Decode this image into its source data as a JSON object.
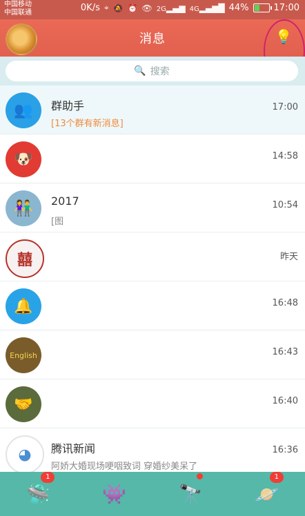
{
  "status_bar": {
    "carrier_1": "中国移动",
    "carrier_2": "中国联通",
    "net_speed": "0K/s",
    "net_type_1": "2G",
    "net_type_2": "4G",
    "battery_percent": "44%",
    "battery_level": 0.44,
    "time": "17:00"
  },
  "header": {
    "title": "消息",
    "bulb_icon": "lightbulb-icon"
  },
  "search": {
    "placeholder": "搜索"
  },
  "conversations": [
    {
      "title": "群助手",
      "subtitle": "[13个群有新消息]",
      "time": "17:00",
      "avatar_icon": "contacts-icon"
    },
    {
      "title": "",
      "subtitle": "",
      "time": "14:58",
      "avatar_icon": "jd-dog-icon"
    },
    {
      "title": "2017",
      "subtitle": "[图",
      "time": "10:54",
      "avatar_icon": "couple-icon"
    },
    {
      "title": "",
      "subtitle": "",
      "time": "昨天",
      "avatar_icon": "seal-icon"
    },
    {
      "title": "",
      "subtitle": "",
      "time": "16:48",
      "avatar_icon": "bell-icon"
    },
    {
      "title": "",
      "subtitle": "",
      "time": "16:43",
      "avatar_icon": "english-icon"
    },
    {
      "title": "",
      "subtitle": "",
      "time": "16:40",
      "avatar_icon": "handshake-icon"
    },
    {
      "title": "腾讯新闻",
      "subtitle": "阿娇大婚现场哽咽致词 穿婚纱美呆了",
      "time": "16:36",
      "avatar_icon": "news-icon"
    }
  ],
  "bottom_nav": [
    {
      "name": "messages",
      "badge": "1"
    },
    {
      "name": "contacts",
      "badge": ""
    },
    {
      "name": "dynamic",
      "badge": ""
    },
    {
      "name": "me",
      "badge": "1"
    }
  ]
}
